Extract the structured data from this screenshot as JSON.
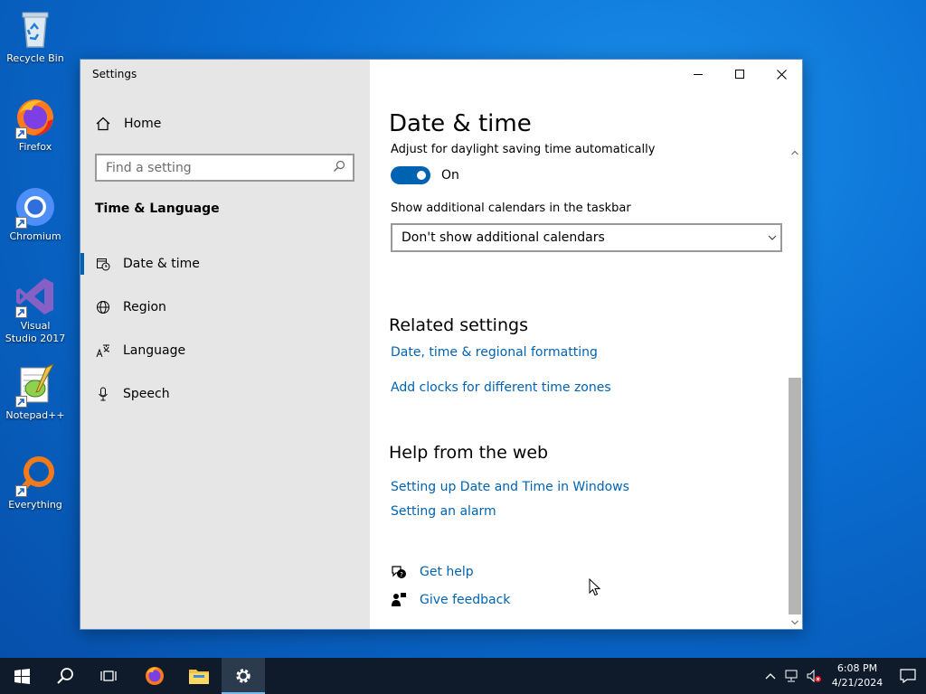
{
  "desktop": {
    "icons": [
      {
        "label": "Recycle Bin",
        "icon": "recycle-bin-icon"
      },
      {
        "label": "Firefox",
        "icon": "firefox-icon"
      },
      {
        "label": "Chromium",
        "icon": "chromium-icon"
      },
      {
        "label": "Visual Studio 2017",
        "icon": "visual-studio-icon"
      },
      {
        "label": "Notepad++",
        "icon": "notepad-plus-plus-icon"
      },
      {
        "label": "Everything",
        "icon": "everything-search-icon"
      }
    ]
  },
  "window": {
    "app_title": "Settings",
    "sidebar": {
      "home_label": "Home",
      "search_placeholder": "Find a setting",
      "section_heading": "Time & Language",
      "items": [
        {
          "label": "Date & time",
          "icon": "calendar-clock-icon",
          "active": true
        },
        {
          "label": "Region",
          "icon": "globe-icon",
          "active": false
        },
        {
          "label": "Language",
          "icon": "language-icon",
          "active": false
        },
        {
          "label": "Speech",
          "icon": "microphone-icon",
          "active": false
        }
      ]
    },
    "content": {
      "page_title": "Date & time",
      "dst_label": "Adjust for daylight saving time automatically",
      "dst_toggle_state": "On",
      "calendars_label": "Show additional calendars in the taskbar",
      "calendars_selected": "Don't show additional calendars",
      "related_heading": "Related settings",
      "related_links": [
        "Date, time & regional formatting",
        "Add clocks for different time zones"
      ],
      "help_heading": "Help from the web",
      "help_links": [
        "Setting up Date and Time in Windows",
        "Setting an alarm"
      ],
      "get_help": "Get help",
      "give_feedback": "Give feedback"
    }
  },
  "taskbar": {
    "time": "6:08 PM",
    "date": "4/21/2024"
  },
  "colors": {
    "accent": "#0063b1",
    "sidebar_bg": "#e6e6e6",
    "taskbar_bg": "#0f1a2b"
  }
}
